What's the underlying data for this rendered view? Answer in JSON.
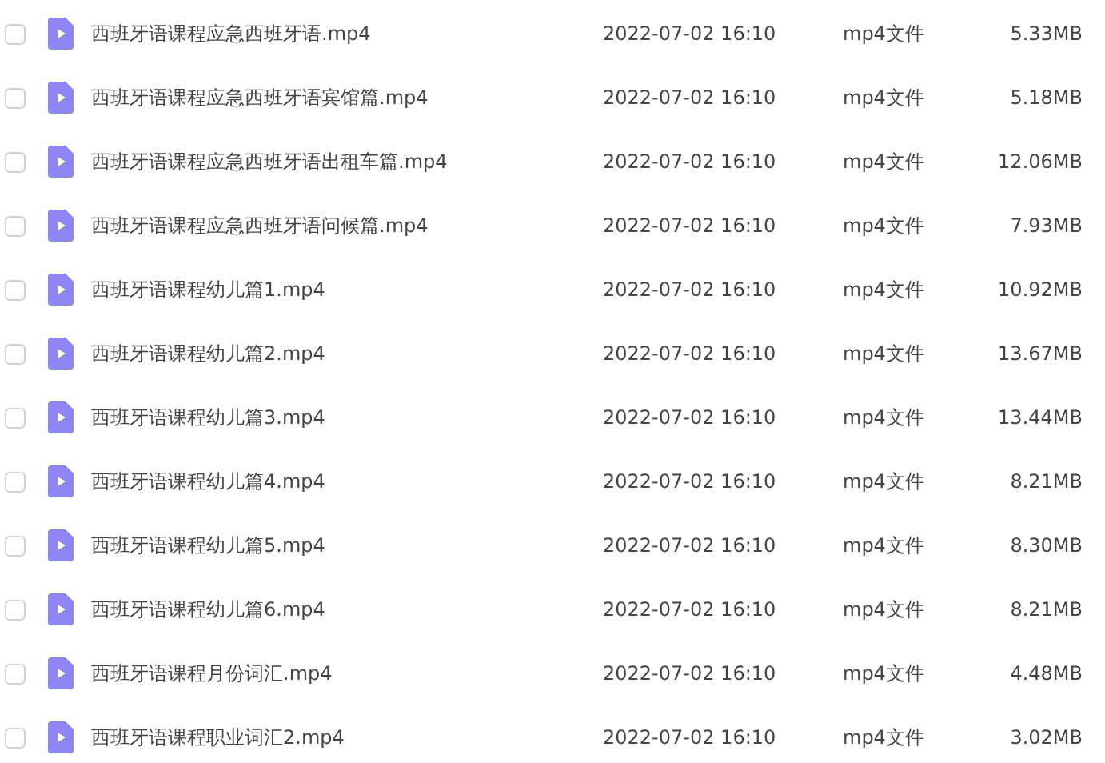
{
  "files": [
    {
      "checked": false,
      "name": "西班牙语课程应急西班牙语.mp4",
      "modified": "2022-07-02 16:10",
      "type": "mp4文件",
      "size": "5.33MB"
    },
    {
      "checked": false,
      "name": "西班牙语课程应急西班牙语宾馆篇.mp4",
      "modified": "2022-07-02 16:10",
      "type": "mp4文件",
      "size": "5.18MB"
    },
    {
      "checked": false,
      "name": "西班牙语课程应急西班牙语出租车篇.mp4",
      "modified": "2022-07-02 16:10",
      "type": "mp4文件",
      "size": "12.06MB"
    },
    {
      "checked": false,
      "name": "西班牙语课程应急西班牙语问候篇.mp4",
      "modified": "2022-07-02 16:10",
      "type": "mp4文件",
      "size": "7.93MB"
    },
    {
      "checked": false,
      "name": "西班牙语课程幼儿篇1.mp4",
      "modified": "2022-07-02 16:10",
      "type": "mp4文件",
      "size": "10.92MB"
    },
    {
      "checked": false,
      "name": "西班牙语课程幼儿篇2.mp4",
      "modified": "2022-07-02 16:10",
      "type": "mp4文件",
      "size": "13.67MB"
    },
    {
      "checked": false,
      "name": "西班牙语课程幼儿篇3.mp4",
      "modified": "2022-07-02 16:10",
      "type": "mp4文件",
      "size": "13.44MB"
    },
    {
      "checked": false,
      "name": "西班牙语课程幼儿篇4.mp4",
      "modified": "2022-07-02 16:10",
      "type": "mp4文件",
      "size": "8.21MB"
    },
    {
      "checked": false,
      "name": "西班牙语课程幼儿篇5.mp4",
      "modified": "2022-07-02 16:10",
      "type": "mp4文件",
      "size": "8.30MB"
    },
    {
      "checked": false,
      "name": "西班牙语课程幼儿篇6.mp4",
      "modified": "2022-07-02 16:10",
      "type": "mp4文件",
      "size": "8.21MB"
    },
    {
      "checked": false,
      "name": "西班牙语课程月份词汇.mp4",
      "modified": "2022-07-02 16:10",
      "type": "mp4文件",
      "size": "4.48MB"
    },
    {
      "checked": false,
      "name": "西班牙语课程职业词汇2.mp4",
      "modified": "2022-07-02 16:10",
      "type": "mp4文件",
      "size": "3.02MB"
    }
  ]
}
